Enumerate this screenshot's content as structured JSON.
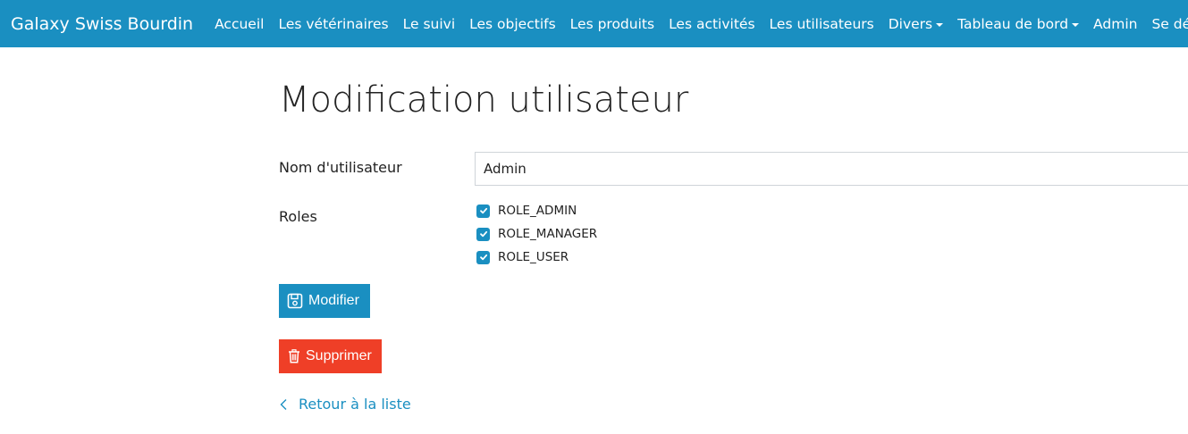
{
  "navbar": {
    "brand": "Galaxy Swiss Bourdin",
    "items": [
      {
        "label": "Accueil"
      },
      {
        "label": "Les vétérinaires"
      },
      {
        "label": "Le suivi"
      },
      {
        "label": "Les objectifs"
      },
      {
        "label": "Les produits"
      },
      {
        "label": "Les activités"
      },
      {
        "label": "Les utilisateurs"
      },
      {
        "label": "Divers",
        "dropdown": true
      },
      {
        "label": "Tableau de bord",
        "dropdown": true
      },
      {
        "label": "Admin"
      },
      {
        "label": "Se déconnecter"
      }
    ],
    "color": "#1a8fc1"
  },
  "page": {
    "title": "Modification utilisateur"
  },
  "form": {
    "username_label": "Nom d'utilisateur",
    "username_value": "Admin",
    "roles_label": "Roles",
    "roles": [
      {
        "label": "ROLE_ADMIN",
        "checked": true
      },
      {
        "label": "ROLE_MANAGER",
        "checked": true
      },
      {
        "label": "ROLE_USER",
        "checked": true
      }
    ]
  },
  "actions": {
    "modify_label": "Modifier",
    "delete_label": "Supprimer",
    "back_label": "Retour à la liste",
    "modify_color": "#1a8fc1",
    "delete_color": "#ef3f27"
  }
}
